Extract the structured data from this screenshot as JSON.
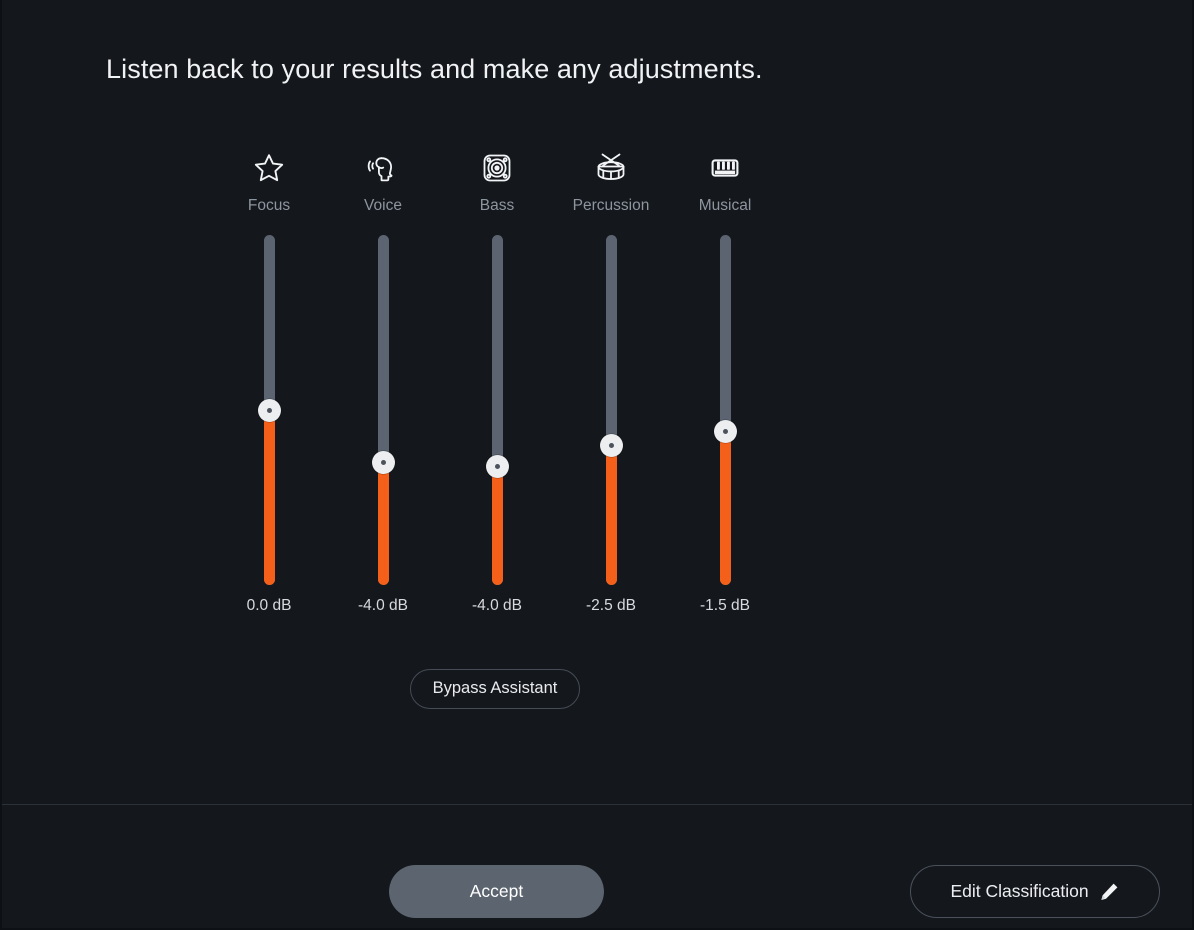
{
  "screen": {
    "background_color": "#14171c",
    "accent_color": "#f4601a",
    "track_color": "#5b6470",
    "title": "Listen back to your results and make any adjustments."
  },
  "sliders": {
    "bands": [
      {
        "label": "Focus",
        "icon": "star-icon",
        "value": "0.0 dB",
        "gain_db": 0.0,
        "fill_ratio": 0.5
      },
      {
        "label": "Voice",
        "icon": "voice-icon",
        "value": "-4.0 dB",
        "gain_db": -4.0,
        "fill_ratio": 0.35
      },
      {
        "label": "Bass",
        "icon": "speaker-icon",
        "value": "-4.0 dB",
        "gain_db": -4.0,
        "fill_ratio": 0.34
      },
      {
        "label": "Percussion",
        "icon": "drum-icon",
        "value": "-2.5 dB",
        "gain_db": -2.5,
        "fill_ratio": 0.4
      },
      {
        "label": "Musical",
        "icon": "piano-icon",
        "value": "-1.5 dB",
        "gain_db": -1.5,
        "fill_ratio": 0.44
      }
    ]
  },
  "bypass": {
    "label": "Bypass Assistant"
  },
  "footer": {
    "accept_label": "Accept",
    "edit_label": "Edit Classification",
    "edit_icon": "pencil-icon"
  }
}
